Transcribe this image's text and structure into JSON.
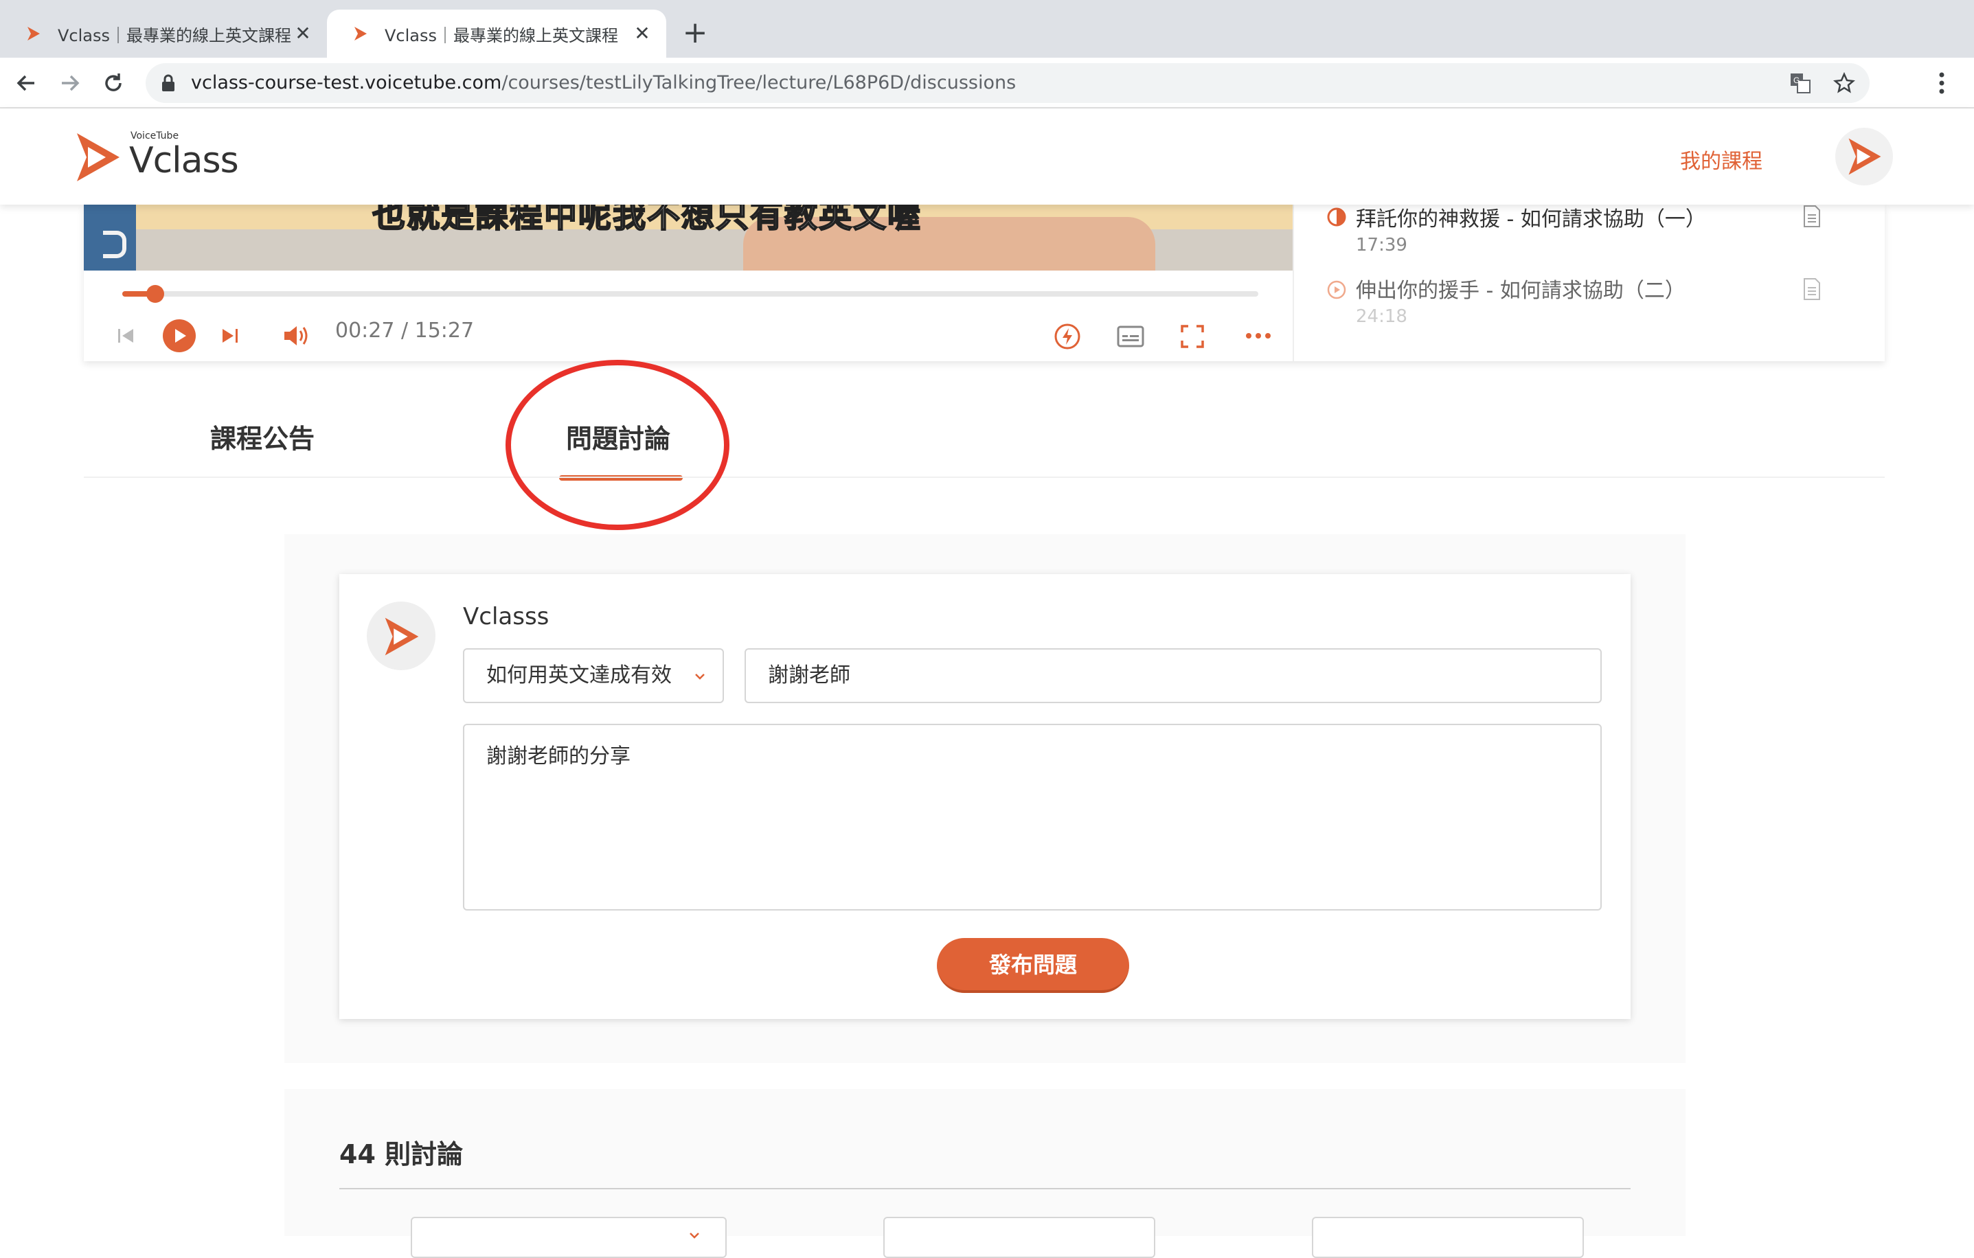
{
  "browser": {
    "tabs": [
      {
        "title": "Vclass｜最專業的線上英文課程",
        "active": false
      },
      {
        "title": "Vclass｜最專業的線上英文課程",
        "active": true
      }
    ],
    "url_host": "vclass-course-test.voicetube.com",
    "url_path": "/courses/testLilyTalkingTree/lecture/L68P6D/discussions",
    "icons": [
      "back-icon",
      "forward-icon",
      "reload-icon",
      "lock-icon",
      "translate-icon",
      "star-icon",
      "menu-icon",
      "close-icon",
      "new-tab-icon"
    ]
  },
  "header": {
    "logo_small": "VoiceTube",
    "logo_big": "Vclass",
    "my_courses": "我的課程",
    "brand_color": "#e06236"
  },
  "player": {
    "subtitle": "也就是課程中呢我不想只有教英文喔",
    "current_time": "00:27",
    "total_time": "15:27",
    "time_display": "00:27 / 15:27",
    "progress": 0.029
  },
  "playlist": {
    "items": [
      {
        "title": "拜託你的神救援 - 如何請求協助（一）",
        "duration": "17:39",
        "status": "in-progress"
      },
      {
        "title": "伸出你的援手 - 如何請求協助（二）",
        "duration": "24:18",
        "status": "not-started"
      }
    ]
  },
  "tabs": {
    "announcements": "課程公告",
    "discussions": "問題討論",
    "active": "discussions"
  },
  "form": {
    "username": "Vclasss",
    "lecture_select": "如何用英文達成有效",
    "title_value": "謝謝老師",
    "body_value": "謝謝老師的分享",
    "submit_label": "發布問題"
  },
  "discussions": {
    "count_label": "44 則討論"
  },
  "annotation": {
    "circle_color": "#e8312a"
  }
}
